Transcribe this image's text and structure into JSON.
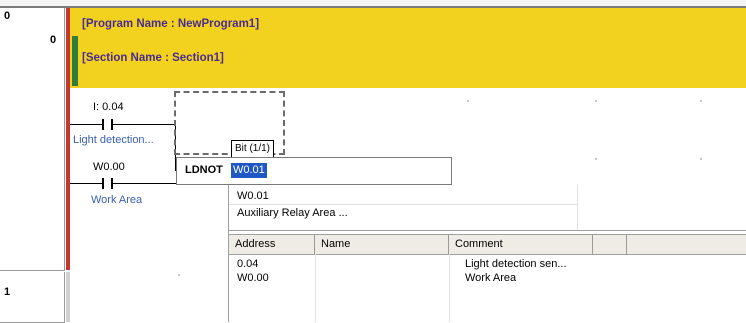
{
  "rungs": [
    {
      "index_top": "0",
      "index_main": "0"
    },
    {
      "index_top": "1"
    }
  ],
  "banner": {
    "program_name": "[Program Name : NewProgram1]",
    "section_name": "[Section Name : Section1]"
  },
  "contacts": [
    {
      "address": "I: 0.04",
      "comment": "Light detection..."
    },
    {
      "address": "W0.00",
      "comment": "Work Area"
    }
  ],
  "tooltip": "Bit (1/1)",
  "edit": {
    "instruction": "LDNOT",
    "value": "W0.01"
  },
  "dropdown": {
    "selected_address": "W0.01",
    "selected_area": "Auxiliary Relay Area ...",
    "columns": [
      "Address",
      "Name",
      "Comment"
    ],
    "rows": [
      {
        "address": "0.04",
        "name": "",
        "comment": "Light detection sen..."
      },
      {
        "address": "W0.00",
        "name": "",
        "comment": "Work Area"
      }
    ]
  }
}
